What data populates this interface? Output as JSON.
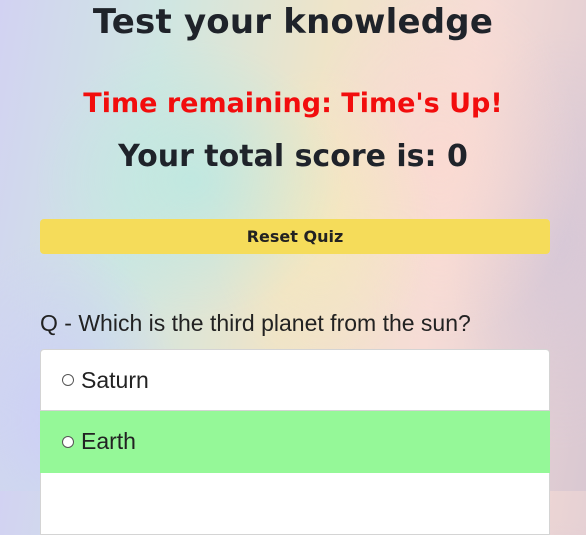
{
  "header": {
    "title": "Test your knowledge"
  },
  "status": {
    "timer_text": "Time remaining: Time's Up!",
    "score_text": "Your total score is: 0"
  },
  "controls": {
    "reset_label": "Reset Quiz"
  },
  "quiz": {
    "question": "Q - Which is the third planet from the sun?",
    "options": [
      {
        "label": "Saturn",
        "state": "default"
      },
      {
        "label": "Earth",
        "state": "correct"
      },
      {
        "label": "",
        "state": "default"
      }
    ]
  },
  "colors": {
    "timer": "#f20d0d",
    "reset_button": "#f5dc5a",
    "correct_answer": "#95f898",
    "text": "#1f232a"
  }
}
